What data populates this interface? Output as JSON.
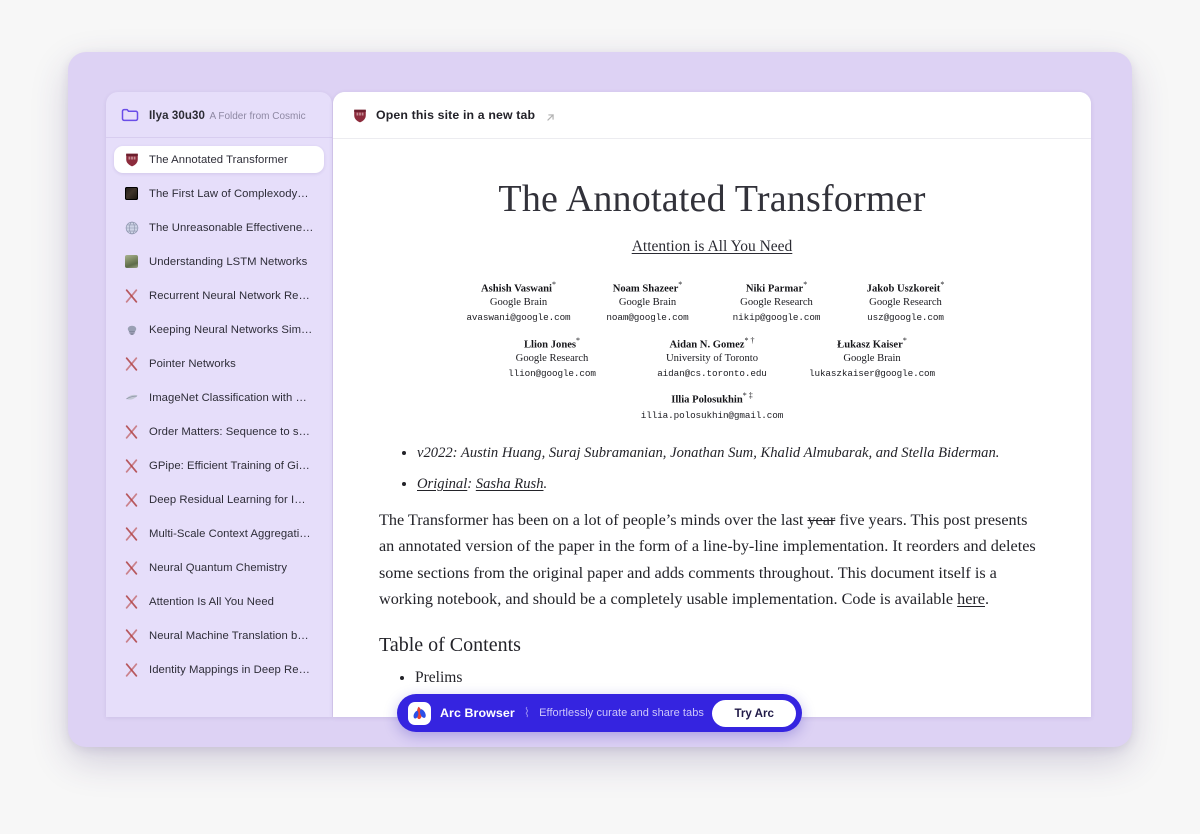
{
  "window": {
    "background_color": "#ddd2f4"
  },
  "sidebar": {
    "folder": {
      "icon": "folder-icon",
      "title": "Ilya 30u30",
      "subtitle": "A Folder from Cosmic"
    },
    "items": [
      {
        "icon": "harvard-crest-icon",
        "label": "The Annotated Transformer",
        "selected": true
      },
      {
        "icon": "dark-thumbnail-icon",
        "label": "The First Law of Complexodyna…",
        "selected": false
      },
      {
        "icon": "globe-icon",
        "label": "The Unreasonable Effectivenes…",
        "selected": false
      },
      {
        "icon": "landscape-thumbnail-icon",
        "label": "Understanding LSTM Networks",
        "selected": false
      },
      {
        "icon": "arxiv-icon",
        "label": "Recurrent Neural Network Regu…",
        "selected": false
      },
      {
        "icon": "brain-icon",
        "label": "Keeping Neural Networks Simpl…",
        "selected": false
      },
      {
        "icon": "arxiv-icon",
        "label": "Pointer Networks",
        "selected": false
      },
      {
        "icon": "leaf-icon",
        "label": "ImageNet Classification with D…",
        "selected": false
      },
      {
        "icon": "arxiv-icon",
        "label": "Order Matters: Sequence to se…",
        "selected": false
      },
      {
        "icon": "arxiv-icon",
        "label": "GPipe: Efficient Training of Gian…",
        "selected": false
      },
      {
        "icon": "arxiv-icon",
        "label": "Deep Residual Learning for Ima…",
        "selected": false
      },
      {
        "icon": "arxiv-icon",
        "label": "Multi-Scale Context Aggregatio…",
        "selected": false
      },
      {
        "icon": "arxiv-icon",
        "label": "Neural Quantum Chemistry",
        "selected": false
      },
      {
        "icon": "arxiv-icon",
        "label": "Attention Is All You Need",
        "selected": false
      },
      {
        "icon": "arxiv-icon",
        "label": "Neural Machine Translation by …",
        "selected": false
      },
      {
        "icon": "arxiv-icon",
        "label": "Identity Mappings in Deep Resi…",
        "selected": false
      }
    ]
  },
  "topbar": {
    "icon": "harvard-crest-icon",
    "label": "Open this site in a new tab",
    "external_icon": "arrow-up-right-icon"
  },
  "document": {
    "title": "The Annotated Transformer",
    "subtitle": "Attention is All You Need",
    "author_rows": [
      [
        {
          "name": "Ashish Vaswani",
          "sup": "*",
          "affiliation": "Google Brain",
          "email": "avaswani@google.com"
        },
        {
          "name": "Noam Shazeer",
          "sup": "*",
          "affiliation": "Google Brain",
          "email": "noam@google.com"
        },
        {
          "name": "Niki Parmar",
          "sup": "*",
          "affiliation": "Google Research",
          "email": "nikip@google.com"
        },
        {
          "name": "Jakob Uszkoreit",
          "sup": "*",
          "affiliation": "Google Research",
          "email": "usz@google.com"
        }
      ],
      [
        {
          "name": "Llion Jones",
          "sup": "*",
          "affiliation": "Google Research",
          "email": "llion@google.com"
        },
        {
          "name": "Aidan N. Gomez",
          "sup": "* †",
          "affiliation": "University of Toronto",
          "email": "aidan@cs.toronto.edu"
        },
        {
          "name": "Łukasz Kaiser",
          "sup": "*",
          "affiliation": "Google Brain",
          "email": "lukaszkaiser@google.com"
        }
      ],
      [
        {
          "name": "Illia Polosukhin",
          "sup": "* ‡",
          "affiliation": "",
          "email": "illia.polosukhin@gmail.com"
        }
      ]
    ],
    "credits": [
      {
        "lead": "v2022:",
        "lead_underline": false,
        "rest": " Austin Huang, Suraj Subramanian, Jonathan Sum, Khalid Almubarak, and Stella Biderman."
      },
      {
        "lead": "Original",
        "lead_underline": true,
        "rest": ": ",
        "link": "Sasha Rush",
        "tail": "."
      }
    ],
    "intro_paragraph": {
      "part1": "The Transformer has been on a lot of people’s minds over the last ",
      "struck": "year",
      "part2": " five years. This post presents an annotated version of the paper in the form of a line-by-line implementation. It reorders and deletes some sections from the original paper and adds comments throughout. This document itself is a working notebook, and should be a completely usable implementation. Code is available ",
      "link": "here",
      "part3": "."
    },
    "toc_heading": "Table of Contents",
    "toc_items": [
      "Prelims"
    ]
  },
  "arc_banner": {
    "logo_icon": "arc-logo-icon",
    "brand": "Arc Browser",
    "divider": "⌇",
    "tagline": "Effortlessly curate and share tabs",
    "cta_label": "Try Arc",
    "background_color": "#3524e0"
  }
}
